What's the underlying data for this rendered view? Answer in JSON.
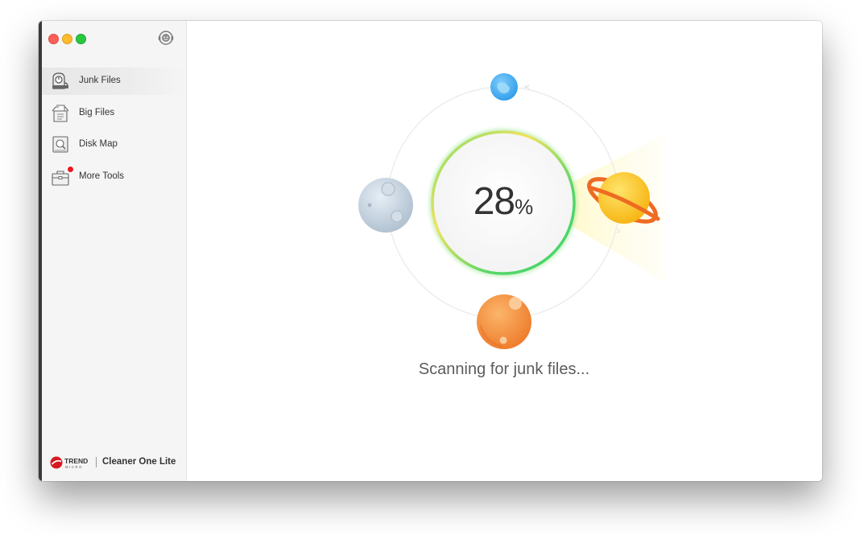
{
  "window": {
    "title": "Cleaner One Lite"
  },
  "sidebar": {
    "items": [
      {
        "label": "Junk Files",
        "icon": "vacuum-icon",
        "active": true,
        "badge": false
      },
      {
        "label": "Big Files",
        "icon": "file-box-icon",
        "active": false,
        "badge": false
      },
      {
        "label": "Disk Map",
        "icon": "disk-map-icon",
        "active": false,
        "badge": false
      },
      {
        "label": "More Tools",
        "icon": "toolbox-icon",
        "active": false,
        "badge": true
      }
    ],
    "support_icon": "support-icon"
  },
  "branding": {
    "logo_text": "TREND",
    "logo_subtext": "MICRO",
    "product_name": "Cleaner One Lite"
  },
  "scan": {
    "progress_value": "28",
    "progress_unit": "%",
    "progress_fraction": 0.28,
    "status": "Scanning for junk files..."
  },
  "colors": {
    "accent_ring_start": "#f2e65a",
    "accent_ring_end": "#3ed46a",
    "badge_red": "#f0141e",
    "planet_blue": "#4fb5f5",
    "planet_orange": "#f08a3a",
    "planet_yellow": "#f8c21a",
    "planet_gray": "#bcccda"
  }
}
